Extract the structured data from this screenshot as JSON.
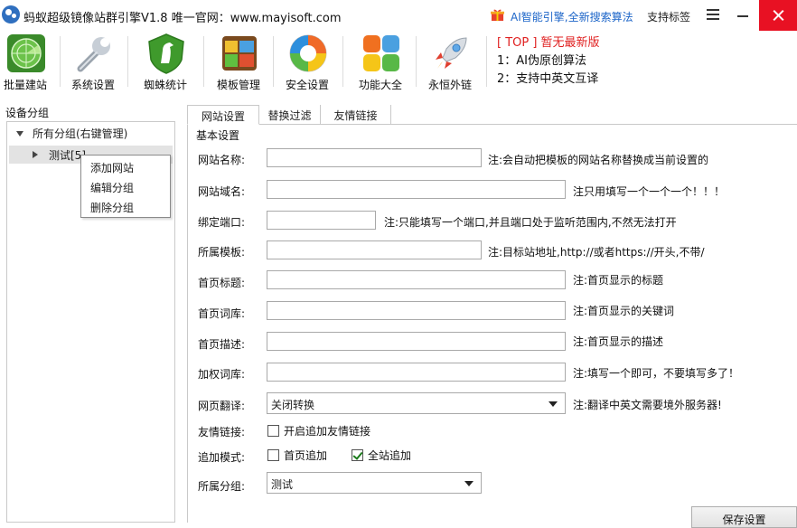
{
  "window": {
    "title": "蚂蚁超级镜像站群引擎V1.8 唯一官网：www.mayisoft.com",
    "ai_promo": "AI智能引擎,全新搜索算法",
    "support_label": "支持标签",
    "icons": [
      "app-logo-icon",
      "gift-icon",
      "menu-icon",
      "minimize-icon",
      "close-icon"
    ]
  },
  "toolbar": {
    "items": [
      {
        "label": "批量建站",
        "icon": "radar-icon"
      },
      {
        "label": "系统设置",
        "icon": "wrench-icon"
      },
      {
        "label": "蜘蛛统计",
        "icon": "shield-horse-icon"
      },
      {
        "label": "模板管理",
        "icon": "template-icon"
      },
      {
        "label": "安全设置",
        "icon": "security-icon"
      },
      {
        "label": "功能大全",
        "icon": "tiles-icon"
      },
      {
        "label": "永恒外链",
        "icon": "rocket-icon"
      }
    ],
    "news": {
      "headline": "[ TOP ] 暂无最新版",
      "line1": "1：AI伪原创算法",
      "line2": "2：支持中英文互译"
    }
  },
  "left": {
    "title": "设备分组",
    "root": "所有分组(右键管理)",
    "child": "测试[5]",
    "context_menu": [
      "添加网站",
      "编辑分组",
      "删除分组"
    ]
  },
  "tabs": [
    "网站设置",
    "替换过滤",
    "友情链接"
  ],
  "form": {
    "section": "基本设置",
    "site_name": {
      "label": "网站名称:",
      "value": "",
      "note": "注:会自动把模板的网站名称替换成当前设置的"
    },
    "domain": {
      "label": "网站域名:",
      "value": "",
      "note": "注只用填写一个一个一个！！！"
    },
    "port": {
      "label": "绑定端口:",
      "value": "",
      "note": "注:只能填写一个端口,并且端口处于监听范围内,不然无法打开"
    },
    "template": {
      "label": "所属模板:",
      "value": "",
      "note": "注:目标站地址,http://或者https://开头,不带/"
    },
    "home_title": {
      "label": "首页标题:",
      "value": "",
      "note": "注:首页显示的标题"
    },
    "home_keywords": {
      "label": "首页词库:",
      "value": "",
      "note": "注:首页显示的关键词"
    },
    "home_desc": {
      "label": "首页描述:",
      "value": "",
      "note": "注:首页显示的描述"
    },
    "weight_keywords": {
      "label": "加权词库:",
      "value": "",
      "note": "注:填写一个即可，不要填写多了！"
    },
    "translate": {
      "label": "网页翻译:",
      "value": "关闭转换",
      "note": "注:翻译中英文需要境外服务器!"
    },
    "friend_links": {
      "label": "友情链接:",
      "option": "开启追加友情链接",
      "checked": false
    },
    "append_mode": {
      "label": "追加模式:",
      "option_home": "首页追加",
      "home_checked": false,
      "option_site": "全站追加",
      "site_checked": true
    },
    "group": {
      "label": "所属分组:",
      "value": "测试"
    },
    "save_label": "保存设置"
  }
}
